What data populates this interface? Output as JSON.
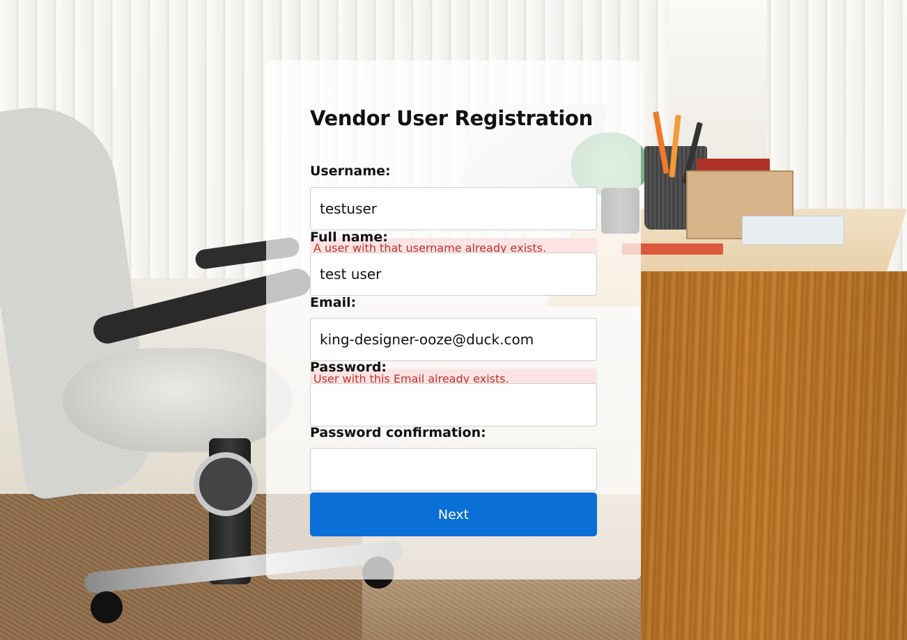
{
  "page": {
    "title": "Vendor User Registration"
  },
  "form": {
    "username": {
      "label": "Username:",
      "value": "testuser",
      "error": "A user with that username already exists."
    },
    "full_name": {
      "label": "Full name:",
      "value": "test user"
    },
    "email": {
      "label": "Email:",
      "value": "king-designer-ooze@duck.com",
      "error": "User with this Email already exists."
    },
    "password": {
      "label": "Password:",
      "value": ""
    },
    "password_confirmation": {
      "label": "Password confirmation:",
      "value": ""
    },
    "submit_label": "Next"
  },
  "colors": {
    "primary_button": "#0a6fd6",
    "error_text": "#c0302a",
    "error_background": "#fde4e4"
  }
}
